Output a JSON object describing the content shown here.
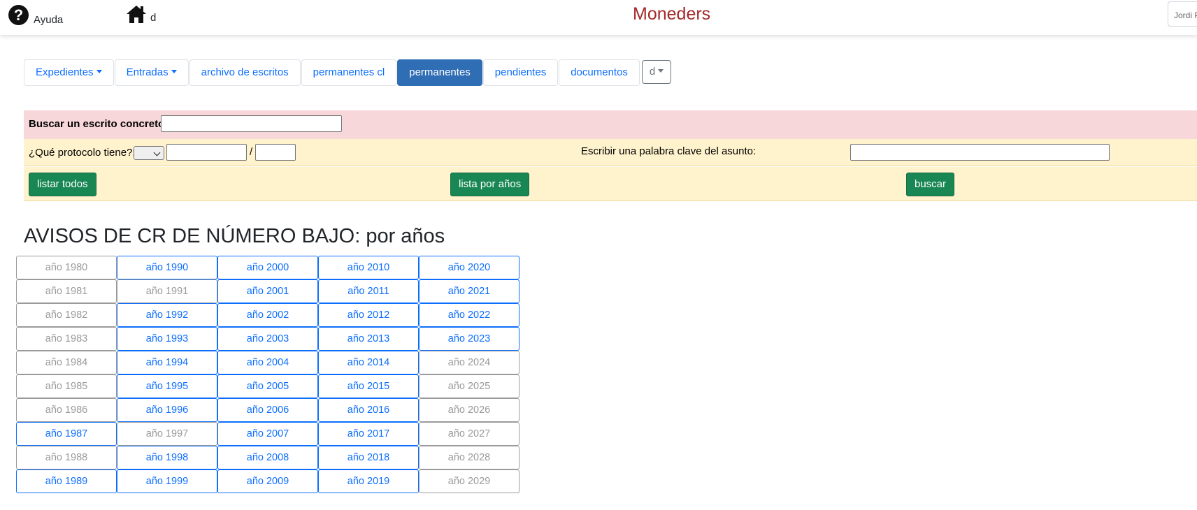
{
  "header": {
    "help_label": "Ayuda",
    "home_label": "d",
    "app_title": "Moneders",
    "user_name": "Jordi P",
    "title_color": "#a52a2a"
  },
  "nav": {
    "items": [
      {
        "label": "Expedientes",
        "dropdown": true,
        "active": false
      },
      {
        "label": "Entradas",
        "dropdown": true,
        "active": false
      },
      {
        "label": "archivo de escritos",
        "dropdown": false,
        "active": false
      },
      {
        "label": "permanentes cl",
        "dropdown": false,
        "active": false
      },
      {
        "label": "permanentes",
        "dropdown": false,
        "active": true
      },
      {
        "label": "pendientes",
        "dropdown": false,
        "active": false
      },
      {
        "label": "documentos",
        "dropdown": false,
        "active": false
      }
    ],
    "extra_dropdown_label": "d",
    "active_color": "#2f6db4"
  },
  "search": {
    "concrete_label": "Buscar un escrito concreto",
    "concrete_value": "",
    "protocol_label": "¿Qué protocolo tiene?:",
    "protocol_select_value": "",
    "protocol_number_value": "",
    "protocol_separator": "/",
    "protocol_year_value": "",
    "keyword_label": "Escribir una palabra clave del asunto:",
    "keyword_value": "",
    "btn_list_all": "listar todos",
    "btn_list_years": "lista por años",
    "btn_search": "buscar"
  },
  "years_section": {
    "title": "AVISOS DE CR DE NÚMERO BAJO: por años",
    "columns": [
      [
        {
          "label": "año 1980",
          "enabled": false
        },
        {
          "label": "año 1981",
          "enabled": false
        },
        {
          "label": "año 1982",
          "enabled": false
        },
        {
          "label": "año 1983",
          "enabled": false
        },
        {
          "label": "año 1984",
          "enabled": false
        },
        {
          "label": "año 1985",
          "enabled": false
        },
        {
          "label": "año 1986",
          "enabled": false
        },
        {
          "label": "año 1987",
          "enabled": true
        },
        {
          "label": "año 1988",
          "enabled": false
        },
        {
          "label": "año 1989",
          "enabled": true
        }
      ],
      [
        {
          "label": "año 1990",
          "enabled": true
        },
        {
          "label": "año 1991",
          "enabled": false
        },
        {
          "label": "año 1992",
          "enabled": true
        },
        {
          "label": "año 1993",
          "enabled": true
        },
        {
          "label": "año 1994",
          "enabled": true
        },
        {
          "label": "año 1995",
          "enabled": true
        },
        {
          "label": "año 1996",
          "enabled": true
        },
        {
          "label": "año 1997",
          "enabled": false
        },
        {
          "label": "año 1998",
          "enabled": true
        },
        {
          "label": "año 1999",
          "enabled": true
        }
      ],
      [
        {
          "label": "año 2000",
          "enabled": true
        },
        {
          "label": "año 2001",
          "enabled": true
        },
        {
          "label": "año 2002",
          "enabled": true
        },
        {
          "label": "año 2003",
          "enabled": true
        },
        {
          "label": "año 2004",
          "enabled": true
        },
        {
          "label": "año 2005",
          "enabled": true
        },
        {
          "label": "año 2006",
          "enabled": true
        },
        {
          "label": "año 2007",
          "enabled": true
        },
        {
          "label": "año 2008",
          "enabled": true
        },
        {
          "label": "año 2009",
          "enabled": true
        }
      ],
      [
        {
          "label": "año 2010",
          "enabled": true
        },
        {
          "label": "año 2011",
          "enabled": true
        },
        {
          "label": "año 2012",
          "enabled": true
        },
        {
          "label": "año 2013",
          "enabled": true
        },
        {
          "label": "año 2014",
          "enabled": true
        },
        {
          "label": "año 2015",
          "enabled": true
        },
        {
          "label": "año 2016",
          "enabled": true
        },
        {
          "label": "año 2017",
          "enabled": true
        },
        {
          "label": "año 2018",
          "enabled": true
        },
        {
          "label": "año 2019",
          "enabled": true
        }
      ],
      [
        {
          "label": "año 2020",
          "enabled": true
        },
        {
          "label": "año 2021",
          "enabled": true
        },
        {
          "label": "año 2022",
          "enabled": true
        },
        {
          "label": "año 2023",
          "enabled": true
        },
        {
          "label": "año 2024",
          "enabled": false
        },
        {
          "label": "año 2025",
          "enabled": false
        },
        {
          "label": "año 2026",
          "enabled": false
        },
        {
          "label": "año 2027",
          "enabled": false
        },
        {
          "label": "año 2028",
          "enabled": false
        },
        {
          "label": "año 2029",
          "enabled": false
        }
      ]
    ]
  }
}
